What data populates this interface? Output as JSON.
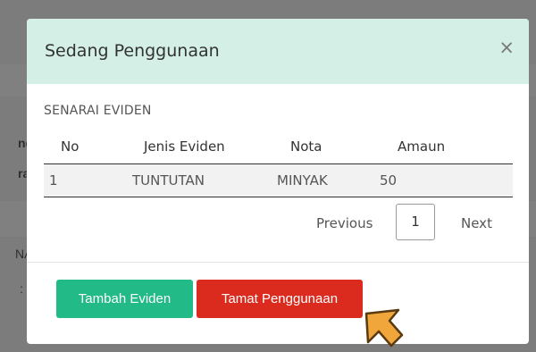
{
  "background": {
    "fragments": [
      "nde",
      "raa",
      "NA",
      ":"
    ]
  },
  "modal": {
    "title": "Sedang Penggunaan",
    "close_label": "×",
    "section_label": "SENARAI EVIDEN",
    "table": {
      "columns": [
        "No",
        "Jenis Eviden",
        "Nota",
        "Amaun"
      ],
      "rows": [
        [
          "1",
          "TUNTUTAN",
          "MINYAK",
          "50"
        ]
      ]
    },
    "pagination": {
      "previous_label": "Previous",
      "current_page": "1",
      "next_label": "Next"
    },
    "footer": {
      "add_label": "Tambah Eviden",
      "end_label": "Tamat Penggunaan"
    }
  },
  "colors": {
    "header_bg": "#d4efe6",
    "add_button": "#22ba86",
    "end_button": "#db2a1e",
    "cursor": "#f0a63a"
  },
  "icons": {
    "close": "close-icon",
    "cursor": "cursor-arrow-icon"
  }
}
